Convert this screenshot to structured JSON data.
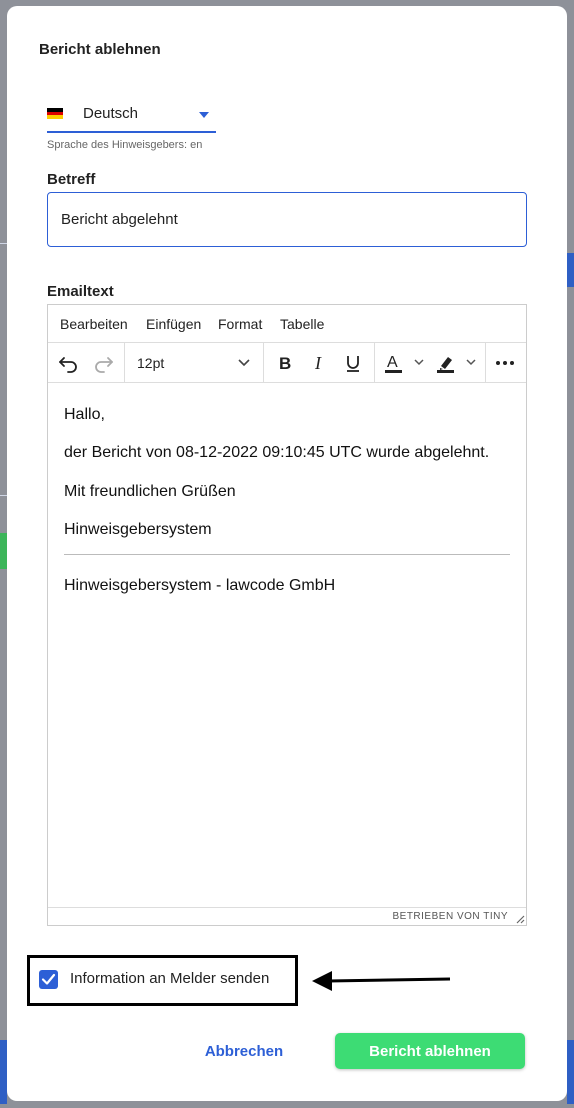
{
  "modal": {
    "title": "Bericht ablehnen",
    "language": {
      "selected": "Deutsch",
      "flag": "germany-flag",
      "hint": "Sprache des Hinweisgebers: en"
    },
    "subject": {
      "label": "Betreff",
      "value": "Bericht abgelehnt"
    },
    "email": {
      "label": "Emailtext",
      "menu": [
        "Bearbeiten",
        "Einfügen",
        "Format",
        "Tabelle"
      ],
      "font_size": "12pt",
      "toolbar_icons": [
        "undo-icon",
        "redo-icon",
        "bold-icon",
        "italic-icon",
        "underline-icon",
        "text-color-icon",
        "highlight-color-icon",
        "more-icon"
      ],
      "body": {
        "greeting": "Hallo,",
        "line1": "der Bericht von 08-12-2022 09:10:45 UTC wurde abgelehnt.",
        "closing": "Mit freundlichen Grüßen",
        "sender": "Hinweisgebersystem",
        "signature": "Hinweisgebersystem - lawcode GmbH"
      },
      "branding": "BETRIEBEN VON TINY"
    },
    "notify": {
      "label": "Information an Melder senden",
      "checked": true
    },
    "buttons": {
      "cancel": "Abbrechen",
      "submit": "Bericht ablehnen"
    }
  },
  "colors": {
    "accent": "#2d5fd6",
    "submit": "#3ddc74",
    "overlay": "#8e9199"
  }
}
